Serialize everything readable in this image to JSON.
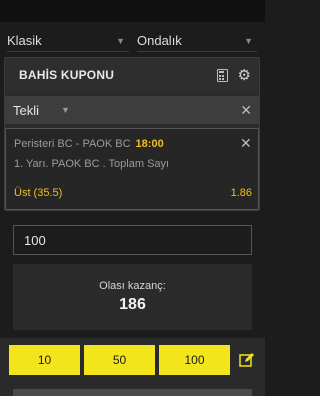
{
  "filters": {
    "left_select": "Klasik",
    "right_select": "Ondalık"
  },
  "coupon": {
    "title": "BAHİS KUPONU",
    "type": "Tekli"
  },
  "bet": {
    "match": "Peristeri BC - PAOK BC",
    "time": "18:00",
    "market": "1. Yarı. PAOK BC . Toplam Sayı",
    "selection": "Üst (35.5)",
    "odds": "1.86"
  },
  "stake": {
    "value": "100"
  },
  "winnings": {
    "label": "Olası kazanç:",
    "value": "186"
  },
  "quick_stakes": [
    "10",
    "50",
    "100"
  ],
  "colors": {
    "accent_yellow": "#f2e51c",
    "odds_yellow": "#f0c020",
    "panel": "#2b2b2b"
  }
}
